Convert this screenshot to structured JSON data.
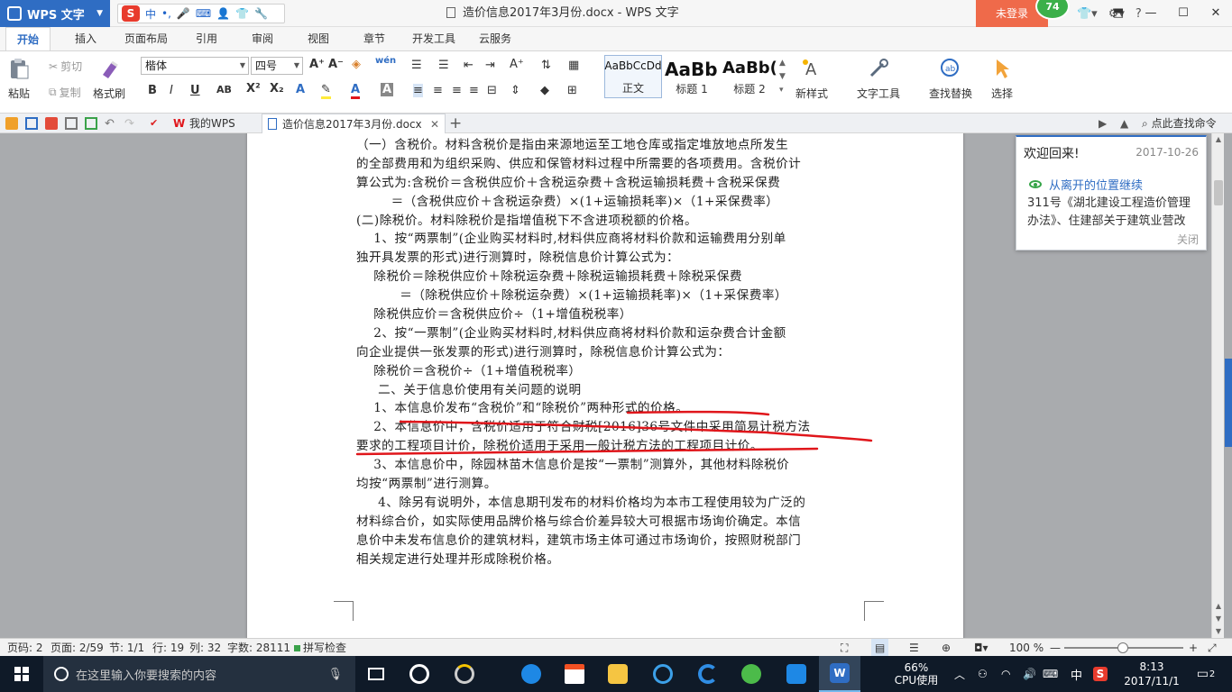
{
  "titlebar": {
    "app_name": "WPS 文字",
    "ime_items": [
      "中",
      "•,"
    ],
    "doc_title": "造价信息2017年3月份.docx - WPS 文字",
    "login": "未登录",
    "score": "74"
  },
  "ribbon_tabs": [
    "开始",
    "插入",
    "页面布局",
    "引用",
    "审阅",
    "视图",
    "章节",
    "开发工具",
    "云服务"
  ],
  "ribbon": {
    "paste": "粘贴",
    "cut": "剪切",
    "copy": "复制",
    "format_painter": "格式刷",
    "font_name": "楷体",
    "font_size": "四号",
    "styles": [
      {
        "sample": "AaBbCcDd",
        "caption": "正文"
      },
      {
        "sample": "AaBb",
        "caption": "标题 1"
      },
      {
        "sample": "AaBb(",
        "caption": "标题 2"
      }
    ],
    "new_style": "新样式",
    "text_tools": "文字工具",
    "find_replace": "查找替换",
    "select": "选择"
  },
  "doc_tabs": {
    "home": "我的WPS",
    "active_doc": "造价信息2017年3月份.docx",
    "search_cmd": "点此查找命令"
  },
  "document": {
    "lines": [
      "（一）含税价。材料含税价是指由来源地运至工地仓库或指定堆放地点所发生",
      "的全部费用和为组织采购、供应和保管材料过程中所需要的各项费用。含税价计",
      "算公式为:含税价＝含税供应价＋含税运杂费＋含税运输损耗费＋含税采保费",
      "        ＝（含税供应价＋含税运杂费）×(1+运输损耗率)×（1+采保费率）",
      "(二)除税价。材料除税价是指增值税下不含进项税额的价格。",
      "    1、按“两票制”(企业购买材料时,材料供应商将材料价款和运输费用分别单",
      "独开具发票的形式)进行测算时，除税信息价计算公式为：",
      "    除税价＝除税供应价＋除税运杂费＋除税运输损耗费＋除税采保费",
      "          ＝（除税供应价＋除税运杂费）×(1+运输损耗率)×（1+采保费率）",
      "    除税供应价＝含税供应价÷（1+增值税税率）",
      "    2、按“一票制”(企业购买材料时,材料供应商将材料价款和运杂费合计金额",
      "向企业提供一张发票的形式)进行测算时，除税信息价计算公式为：",
      "    除税价＝含税价÷（1+增值税税率）",
      "     二、关于信息价使用有关问题的说明",
      "    1、本信息价发布“含税价”和“除税价”两种形式的价格。",
      "    2、本信息价中，含税价适用于符合财税[2016]36号文件中采用简易计税方法",
      "要求的工程项目计价，除税价适用于采用一般计税方法的工程项目计价。",
      "    3、本信息价中，除园林苗木信息价是按“一票制”测算外，其他材料除税价",
      "均按“两票制”进行测算。",
      "     4、除另有说明外，本信息期刊发布的材料价格均为本市工程使用较为广泛的",
      "材料综合价，如实际使用品牌价格与综合价差异较大可根据市场询价确定。本信",
      "息价中未发布信息价的建筑材料，建筑市场主体可通过市场询价，按照财税部门",
      "相关规定进行处理并形成除税价格。"
    ]
  },
  "welcome": {
    "title": "欢迎回来!",
    "date": "2017-10-26",
    "resume": "从离开的位置继续",
    "snippet": "311号《湖北建设工程造价管理办法》、住建部关于建筑业营改",
    "close": "关闭"
  },
  "statusbar": {
    "page_code": "页码: 2",
    "page": "页面: 2/59",
    "section": "节: 1/1",
    "row": "行: 19",
    "col": "列: 32",
    "words": "字数: 28111",
    "spell": "拼写检查",
    "zoom": "100 %"
  },
  "taskbar": {
    "search_placeholder": "在这里输入你要搜索的内容",
    "cpu_pct": "66%",
    "cpu_label": "CPU使用",
    "lang": "中",
    "time": "8:13",
    "date": "2017/11/1",
    "notif_count": "2"
  },
  "colors": {
    "accent": "#2f6dc3",
    "annotation_red": "#e0161b",
    "login_orange": "#ef6a4a",
    "taskbar": "#0f1a28"
  }
}
